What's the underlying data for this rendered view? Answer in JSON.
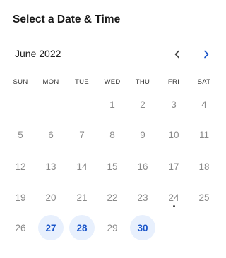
{
  "header": {
    "title": "Select a Date & Time"
  },
  "calendar": {
    "month_label": "June 2022",
    "prev_icon": "chevron-left-icon",
    "next_icon": "chevron-right-icon",
    "weekdays": [
      "SUN",
      "MON",
      "TUE",
      "WED",
      "THU",
      "FRI",
      "SAT"
    ],
    "weeks": [
      [
        {
          "label": ""
        },
        {
          "label": ""
        },
        {
          "label": ""
        },
        {
          "label": "1",
          "available": false
        },
        {
          "label": "2",
          "available": false
        },
        {
          "label": "3",
          "available": false
        },
        {
          "label": "4",
          "available": false
        }
      ],
      [
        {
          "label": "5",
          "available": false
        },
        {
          "label": "6",
          "available": false
        },
        {
          "label": "7",
          "available": false
        },
        {
          "label": "8",
          "available": false
        },
        {
          "label": "9",
          "available": false
        },
        {
          "label": "10",
          "available": false
        },
        {
          "label": "11",
          "available": false
        }
      ],
      [
        {
          "label": "12",
          "available": false
        },
        {
          "label": "13",
          "available": false
        },
        {
          "label": "14",
          "available": false
        },
        {
          "label": "15",
          "available": false
        },
        {
          "label": "16",
          "available": false
        },
        {
          "label": "17",
          "available": false
        },
        {
          "label": "18",
          "available": false
        }
      ],
      [
        {
          "label": "19",
          "available": false
        },
        {
          "label": "20",
          "available": false
        },
        {
          "label": "21",
          "available": false
        },
        {
          "label": "22",
          "available": false
        },
        {
          "label": "23",
          "available": false
        },
        {
          "label": "24",
          "available": false,
          "today": true
        },
        {
          "label": "25",
          "available": false
        }
      ],
      [
        {
          "label": "26",
          "available": false
        },
        {
          "label": "27",
          "available": true
        },
        {
          "label": "28",
          "available": true
        },
        {
          "label": "29",
          "available": false
        },
        {
          "label": "30",
          "available": true
        },
        {
          "label": ""
        },
        {
          "label": ""
        }
      ]
    ]
  },
  "colors": {
    "accent": "#1a55c9",
    "available_bg": "#e8f0fd",
    "unavailable_text": "#8a8a8a",
    "nav_prev": "#444444",
    "nav_next": "#1a55c9"
  }
}
